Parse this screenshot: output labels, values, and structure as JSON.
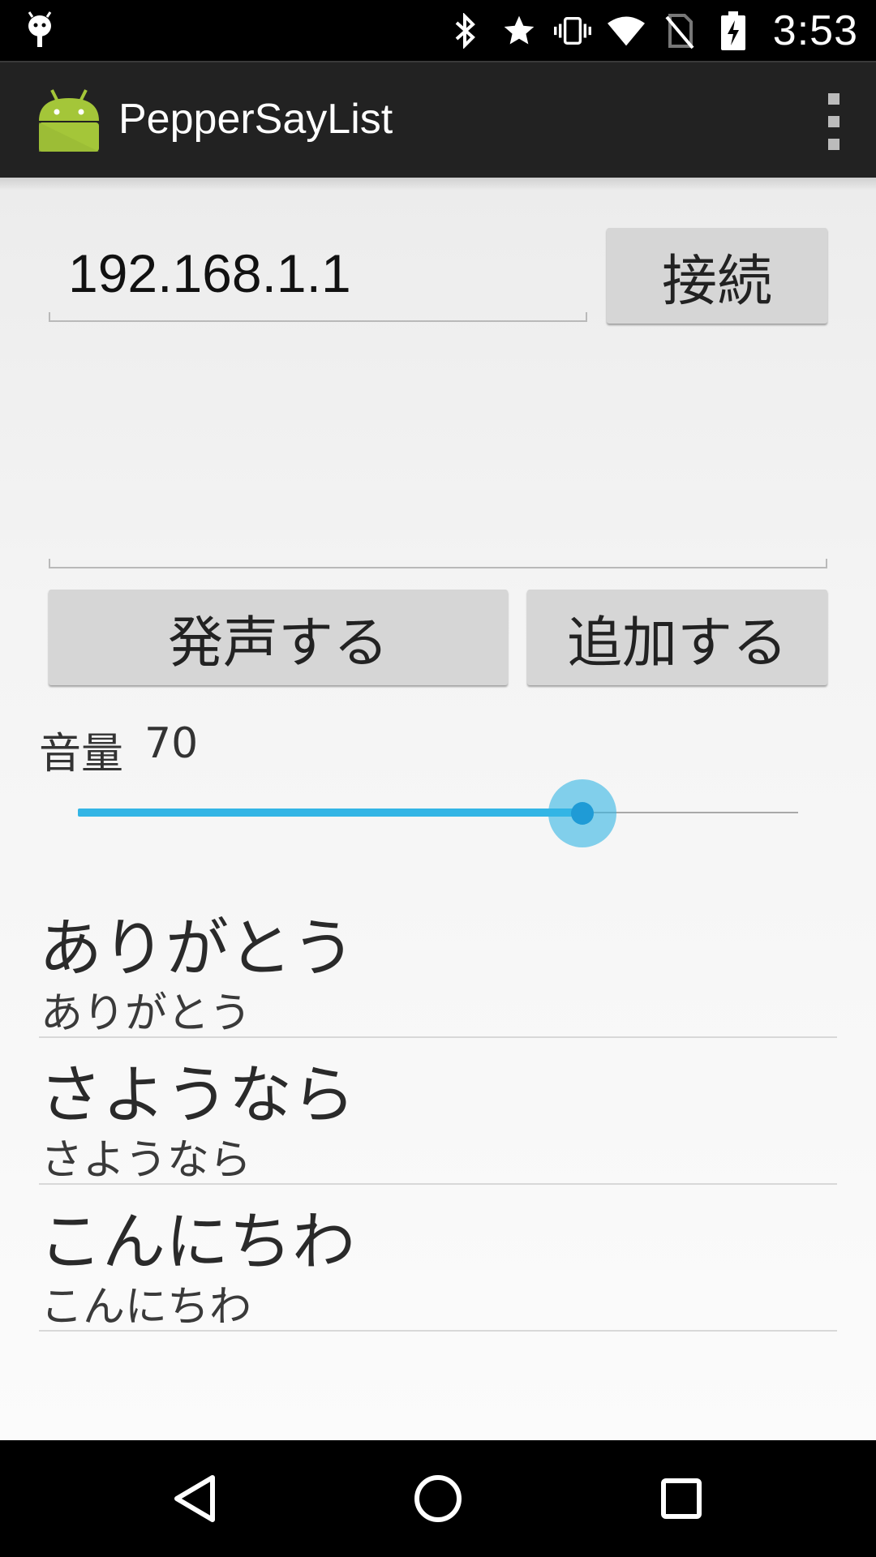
{
  "status_bar": {
    "time": "3:53",
    "icons": [
      "debug-icon",
      "bluetooth-icon",
      "star-icon",
      "vibrate-icon",
      "wifi-icon",
      "no-sim-icon",
      "battery-charging-icon"
    ]
  },
  "action_bar": {
    "title": "PepperSayList",
    "app_icon": "android-icon",
    "overflow_icon": "overflow-menu-icon"
  },
  "connection": {
    "ip_value": "192.168.1.1",
    "connect_label": "接続"
  },
  "message": {
    "value": ""
  },
  "actions": {
    "speak_label": "発声する",
    "add_label": "追加する"
  },
  "volume": {
    "label": "音量",
    "value": "70",
    "fraction": 0.7
  },
  "phrases": [
    {
      "title": "ありがとう",
      "subtitle": "ありがとう"
    },
    {
      "title": "さようなら",
      "subtitle": "さようなら"
    },
    {
      "title": "こんにちわ",
      "subtitle": "こんにちわ"
    }
  ],
  "colors": {
    "accent": "#33b5e5",
    "android_green": "#a4c639"
  },
  "nav_bar": {
    "icons": [
      "back-icon",
      "home-icon",
      "recents-icon"
    ]
  }
}
